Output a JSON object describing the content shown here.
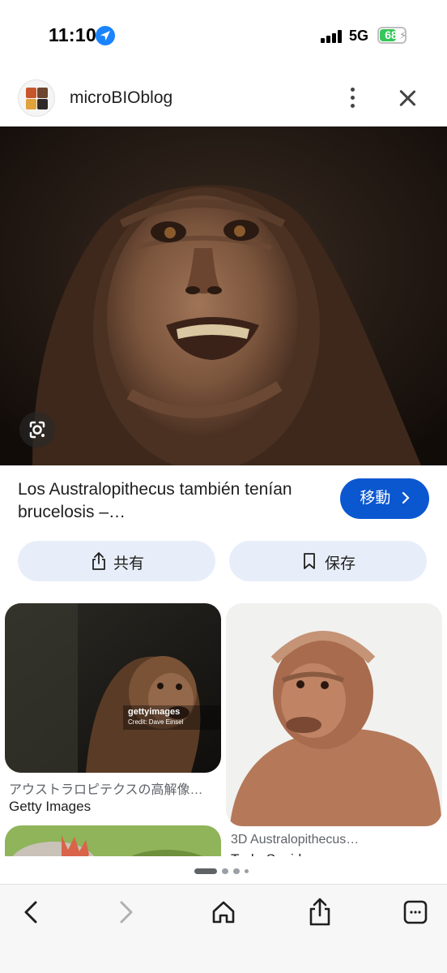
{
  "status": {
    "time": "11:10",
    "network": "5G",
    "battery": "68",
    "battery_level": 0.68
  },
  "header": {
    "site_name": "microBIOblog"
  },
  "result": {
    "title": "Los Australopithecus también tenían brucelosis –…",
    "visit_label": "移動"
  },
  "actions": {
    "share_label": "共有",
    "save_label": "保存"
  },
  "related": [
    {
      "caption": "アウストラロピテクスの高解像…",
      "source": "Getty Images",
      "watermark": "gettyimages",
      "credit": "Credit: Dave Einsel"
    },
    {
      "caption": "3D Australopithecus…",
      "source": "TurboSquid"
    }
  ],
  "colors": {
    "accent": "#0b57d0",
    "pill_bg": "#e8eef9",
    "battery": "#34c759"
  },
  "icons": {
    "location": "location-arrow-icon",
    "lens": "google-lens-icon",
    "share": "share-icon",
    "bookmark": "bookmark-icon",
    "back": "back-chevron-icon",
    "forward": "forward-chevron-icon",
    "home": "home-icon",
    "tabs": "tabs-icon"
  }
}
